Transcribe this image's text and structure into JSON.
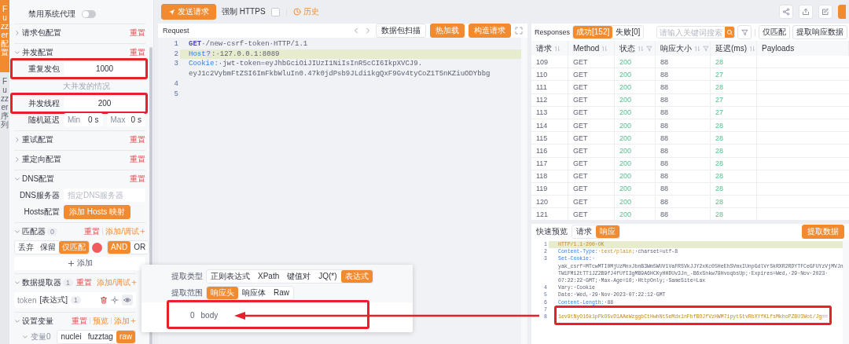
{
  "side_tabs": [
    {
      "label": "Fuzzer 配置",
      "selected": true
    },
    {
      "label": "Fuzzer 序列",
      "selected": false
    }
  ],
  "config": {
    "proxy_toggle": {
      "label": "禁用系统代理",
      "on": false
    },
    "sections": [
      {
        "kind": "plain",
        "title": "请求包配置",
        "expanded": false,
        "actions": [
          {
            "label": "重置",
            "kind": "reset"
          }
        ]
      },
      {
        "kind": "concurrency",
        "title": "并发配置",
        "expanded": true,
        "actions": [
          {
            "label": "重置",
            "kind": "reset"
          }
        ],
        "repeat": {
          "label": "重复发包",
          "value": "1000",
          "annotated": true
        },
        "hint": "大并发的情况",
        "threads": {
          "label": "并发线程",
          "value": "200",
          "annotated": true
        },
        "delay": {
          "label": "随机延迟",
          "min_label": "Min",
          "min": "0",
          "min_unit": "s",
          "max_label": "Max",
          "max": "0",
          "max_unit": "s"
        }
      },
      {
        "kind": "plain",
        "title": "重试配置",
        "expanded": false,
        "actions": [
          {
            "label": "重置",
            "kind": "reset"
          }
        ]
      },
      {
        "kind": "plain",
        "title": "重定向配置",
        "expanded": false,
        "actions": [
          {
            "label": "重置",
            "kind": "reset"
          }
        ]
      },
      {
        "kind": "dns",
        "title": "DNS配置",
        "expanded": true,
        "actions": [
          {
            "label": "重置",
            "kind": "reset"
          }
        ],
        "server": {
          "label": "DNS服务器",
          "placeholder": "指定DNS服务器"
        },
        "hosts": {
          "label": "Hosts配置",
          "button": "添加 Hosts 映射"
        }
      },
      {
        "kind": "matcher",
        "title": "匹配器",
        "count": "0",
        "expanded": true,
        "actions": [
          {
            "label": "重置",
            "kind": "reset"
          },
          {
            "label": "添加/调试",
            "kind": "add"
          }
        ],
        "modes": [
          {
            "label": "丢弃",
            "selected": false
          },
          {
            "label": "保留",
            "selected": false
          },
          {
            "label": "仅匹配",
            "selected": true
          }
        ],
        "logic": [
          {
            "label": "AND",
            "selected": true
          },
          {
            "label": "OR",
            "selected": false
          }
        ],
        "add_button": "添加"
      },
      {
        "kind": "extractor",
        "title": "数据提取器",
        "count": "1",
        "expanded": true,
        "actions": [
          {
            "label": "重置",
            "kind": "reset"
          },
          {
            "label": "添加/调试",
            "kind": "add"
          }
        ],
        "items": [
          {
            "name": "token",
            "type": "[表达式]",
            "count": "1"
          }
        ]
      },
      {
        "kind": "variables",
        "title": "设置变量",
        "expanded": true,
        "actions": [
          {
            "label": "重置",
            "kind": "reset"
          },
          {
            "label": "预览",
            "kind": "link"
          },
          {
            "label": "添加",
            "kind": "add"
          }
        ],
        "variables": [
          {
            "name": "变量0",
            "expanded": true,
            "modes": [
              {
                "label": "nuclei",
                "selected": false
              },
              {
                "label": "fuzztag",
                "selected": false
              },
              {
                "label": "raw",
                "selected": true
              }
            ]
          }
        ]
      }
    ]
  },
  "toolbar": {
    "send": "发送请求",
    "https": {
      "label": "强制 HTTPS",
      "checked": false
    },
    "history": "历史"
  },
  "request": {
    "title": "Request",
    "buttons": [
      {
        "label": "数据包扫描",
        "kind": "plain"
      },
      {
        "label": "热加载",
        "kind": "primary"
      },
      {
        "label": "构造请求",
        "kind": "primary"
      }
    ],
    "lines": [
      {
        "number": "1",
        "highlighted": false,
        "segments": [
          {
            "text": "GET",
            "kind": "method"
          },
          {
            "text": "·/new-csrf-token·HTTP/1.1",
            "kind": "plain"
          }
        ]
      },
      {
        "number": "2",
        "highlighted": true,
        "segments": [
          {
            "text": "Host",
            "kind": "key"
          },
          {
            "text": "?",
            "kind": "badge"
          },
          {
            "text": ":·127.0.0.1:8089",
            "kind": "plain"
          }
        ]
      },
      {
        "number": "3",
        "highlighted": false,
        "segments": [
          {
            "text": "Cookie:",
            "kind": "key"
          },
          {
            "text": "·jwt-token=eyJhbGciOiJIUzI1NiIsInR5cCI6IkpXVCJ9.",
            "kind": "plain"
          }
        ],
        "continuation": [
          "eyJ1c2VybmFtZSI6ImFkbWluIn0.47k0jdPsb9JLdi1kgQxF9Gv4tyCoZ1T5nKZiuODYbbg"
        ]
      },
      {
        "number": "4"
      },
      {
        "number": "5"
      }
    ]
  },
  "responses": {
    "title": "Responses",
    "tabs": [
      {
        "label": "成功[152]",
        "selected": true
      },
      {
        "label": "失败[0]",
        "selected": false
      }
    ],
    "search_placeholder": "请输入关键词搜索",
    "buttons": [
      "仅匹配",
      "提取响应数据"
    ],
    "columns": [
      {
        "label": "请求",
        "kind": "text",
        "sortable": true,
        "filterable": false
      },
      {
        "label": "Method",
        "kind": "text",
        "sortable": true,
        "filterable": false
      },
      {
        "label": "状态",
        "kind": "good",
        "sortable": true,
        "filterable": true
      },
      {
        "label": "响应大小",
        "kind": "text",
        "sortable": true,
        "filterable": true
      },
      {
        "label": "延迟(ms)",
        "kind": "good",
        "sortable": true,
        "filterable": false
      },
      {
        "label": "Payloads",
        "kind": "text",
        "sortable": false,
        "filterable": false
      }
    ],
    "rows": [
      [
        "109",
        "GET",
        "200",
        "88",
        "28"
      ],
      [
        "110",
        "GET",
        "200",
        "88",
        "27"
      ],
      [
        "111",
        "GET",
        "200",
        "88",
        "28"
      ],
      [
        "112",
        "GET",
        "200",
        "88",
        "27"
      ],
      [
        "113",
        "GET",
        "200",
        "88",
        "27"
      ],
      [
        "114",
        "GET",
        "200",
        "88",
        "28"
      ],
      [
        "115",
        "GET",
        "200",
        "88",
        "28"
      ],
      [
        "116",
        "GET",
        "200",
        "88",
        "28"
      ],
      [
        "117",
        "GET",
        "200",
        "88",
        "28"
      ],
      [
        "118",
        "GET",
        "200",
        "88",
        "28"
      ],
      [
        "119",
        "GET",
        "200",
        "88",
        "28"
      ],
      [
        "120",
        "GET",
        "200",
        "88",
        "28"
      ],
      [
        "121",
        "GET",
        "200",
        "88",
        "28"
      ]
    ]
  },
  "preview": {
    "title": "快速预览",
    "tabs": [
      {
        "label": "请求",
        "selected": false
      },
      {
        "label": "响应",
        "selected": true
      }
    ],
    "button": "提取数据",
    "lines": [
      {
        "number": "1",
        "highlighted": true,
        "segments": [
          {
            "text": "HTTP/1.1·200·OK",
            "kind": "value"
          }
        ]
      },
      {
        "number": "2",
        "highlighted": false,
        "segments": [
          {
            "text": "Content-Type:",
            "kind": "key"
          },
          {
            "text": "·text/plain;",
            "kind": "value"
          },
          {
            "text": "·charset=utf-8",
            "kind": "plain"
          }
        ]
      },
      {
        "number": "3",
        "highlighted": false,
        "segments": [
          {
            "text": "Set-Cookie:·",
            "kind": "key"
          }
        ],
        "continuation": [
          "yak_csrf=MTcwMTI0MjUzMnxJbnB3Wm5WUV1VaFRSVkJJY2xKc05HeEhSVmxIUnpGdlVrSkRXR2RDYTFCeGFUYzVjMVJn",
          "TW1FM12tTT1JZ2B9fJ4fUfI3gMB9A6HCKyHHDUv3Jn_-B6xSnkw79HvoqbsUp;·Expires=Wed,·29·Nov·2023·",
          "07:22:22·GMT;·Max-Age=10;·HttpOnly;·SameSite=Lax"
        ]
      },
      {
        "number": "4",
        "highlighted": false,
        "segments": [
          {
            "text": "Vary:·Cookie",
            "kind": "plain"
          }
        ]
      },
      {
        "number": "5",
        "highlighted": false,
        "segments": [
          {
            "text": "Date:·Wed,·29·Nov·2023·07:22:12·GMT",
            "kind": "plain"
          }
        ]
      },
      {
        "number": "6",
        "highlighted": false,
        "segments": [
          {
            "text": "Content-Length:",
            "kind": "key"
          },
          {
            "text": "·88",
            "kind": "plain"
          }
        ]
      },
      {
        "number": "7"
      },
      {
        "number": "8",
        "highlighted": false,
        "annotated": true,
        "segments": [
          {
            "text": "1ev9tNyO16k1pPkO5vD1AAeWzggbCtHwhNt5eMdx1nFbfBOJfVzHWM7ipyt5tvRbXYfKLfsMkhoPZBUIWot/Jg==",
            "kind": "body"
          }
        ]
      }
    ]
  },
  "extract_popup": {
    "type_label": "提取类型",
    "types": [
      {
        "label": "正则表达式",
        "selected": false
      },
      {
        "label": "XPath",
        "selected": false
      },
      {
        "label": "键值对",
        "selected": false
      },
      {
        "label": "JQ(*)",
        "selected": false
      },
      {
        "label": "表达式",
        "selected": true
      }
    ],
    "scope_label": "提取范围",
    "scopes": [
      {
        "label": "响应头",
        "selected": true
      },
      {
        "label": "响应体",
        "selected": false
      },
      {
        "label": "Raw",
        "selected": false
      }
    ],
    "results": [
      {
        "index": "0",
        "value": "body",
        "annotated": true
      }
    ]
  }
}
